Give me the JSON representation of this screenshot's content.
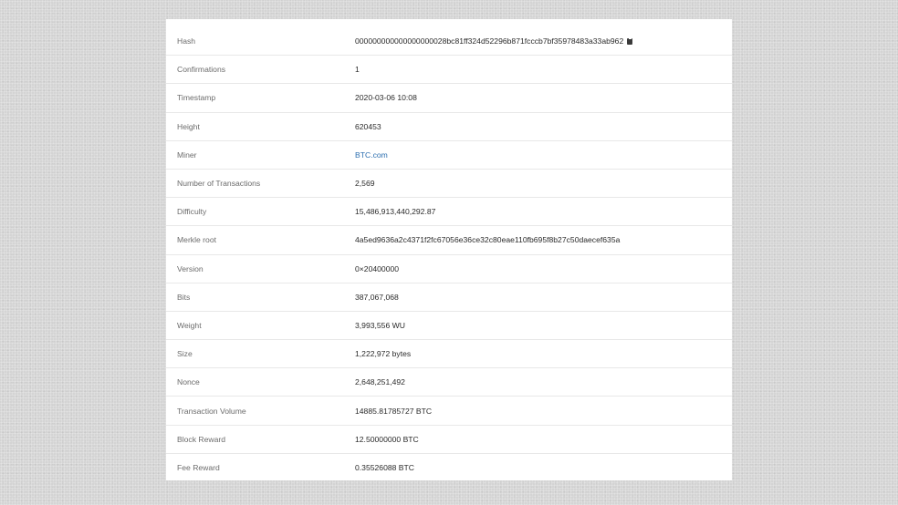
{
  "block_details": {
    "rows": [
      {
        "label": "Hash",
        "value": "000000000000000000028bc81ff324d52296b871fcccb7bf35978483a33ab962",
        "copy_icon": "clipboard-icon"
      },
      {
        "label": "Confirmations",
        "value": "1"
      },
      {
        "label": "Timestamp",
        "value": "2020-03-06 10:08"
      },
      {
        "label": "Height",
        "value": "620453"
      },
      {
        "label": "Miner",
        "value": "BTC.com",
        "link_color": "#2d6fb0"
      },
      {
        "label": "Number of Transactions",
        "value": "2,569"
      },
      {
        "label": "Difficulty",
        "value": "15,486,913,440,292.87"
      },
      {
        "label": "Merkle root",
        "value": "4a5ed9636a2c4371f2fc67056e36ce32c80eae110fb695f8b27c50daecef635a"
      },
      {
        "label": "Version",
        "value": "0×20400000"
      },
      {
        "label": "Bits",
        "value": "387,067,068"
      },
      {
        "label": "Weight",
        "value": "3,993,556 WU"
      },
      {
        "label": "Size",
        "value": "1,222,972 bytes"
      },
      {
        "label": "Nonce",
        "value": "2,648,251,492"
      },
      {
        "label": "Transaction Volume",
        "value": "14885.81785727 BTC"
      },
      {
        "label": "Block Reward",
        "value": "12.50000000 BTC"
      },
      {
        "label": "Fee Reward",
        "value": "0.35526088 BTC"
      }
    ]
  }
}
